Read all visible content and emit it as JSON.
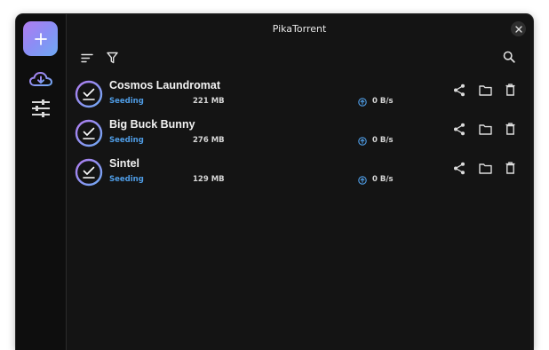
{
  "app": {
    "title": "PikaTorrent"
  },
  "sidebar": {
    "add_icon": "plus-icon",
    "items": [
      {
        "name": "cloud-download-icon"
      },
      {
        "name": "sliders-icon"
      }
    ]
  },
  "toolbar": {
    "sort_icon": "sort-icon",
    "filter_icon": "filter-icon",
    "search_icon": "search-icon"
  },
  "torrents": [
    {
      "name": "Cosmos Laundromat",
      "status": "Seeding",
      "size": "221 MB",
      "speed": "0 B/s"
    },
    {
      "name": "Big Buck Bunny",
      "status": "Seeding",
      "size": "276 MB",
      "speed": "0 B/s"
    },
    {
      "name": "Sintel",
      "status": "Seeding",
      "size": "129 MB",
      "speed": "0 B/s"
    }
  ],
  "colors": {
    "accent_status": "#4f9de6",
    "gradient_start": "#b07cf0",
    "gradient_end": "#6fa9f3"
  }
}
